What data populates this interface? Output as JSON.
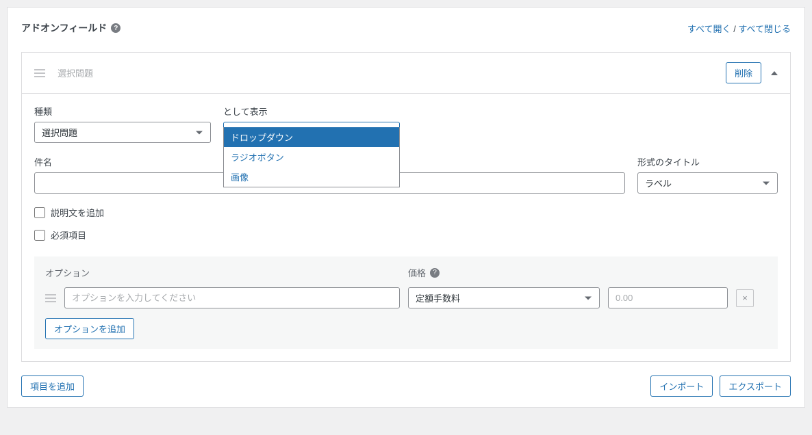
{
  "header": {
    "title": "アドオンフィールド",
    "expand_all": "すべて開く",
    "collapse_all": "すべて閉じる"
  },
  "item": {
    "head_title": "選択問題",
    "delete_btn": "削除",
    "type_label": "種類",
    "type_value": "選択問題",
    "display_as_label": "として表示",
    "display_as_value": "ドロップダウン",
    "display_as_options": {
      "dropdown": "ドロップダウン",
      "radio": "ラジオボタン",
      "image": "画像"
    },
    "subject_label": "件名",
    "title_format_label": "形式のタイトル",
    "title_format_value": "ラベル",
    "add_desc_label": "説明文を追加",
    "required_label": "必須項目",
    "options": {
      "heading_option": "オプション",
      "heading_price": "価格",
      "name_placeholder": "オプションを入力してください",
      "type_value": "定額手数料",
      "price_placeholder": "0.00",
      "add_option_btn": "オプションを追加"
    }
  },
  "footer": {
    "add_item_btn": "項目を追加",
    "import_btn": "インポート",
    "export_btn": "エクスポート"
  }
}
